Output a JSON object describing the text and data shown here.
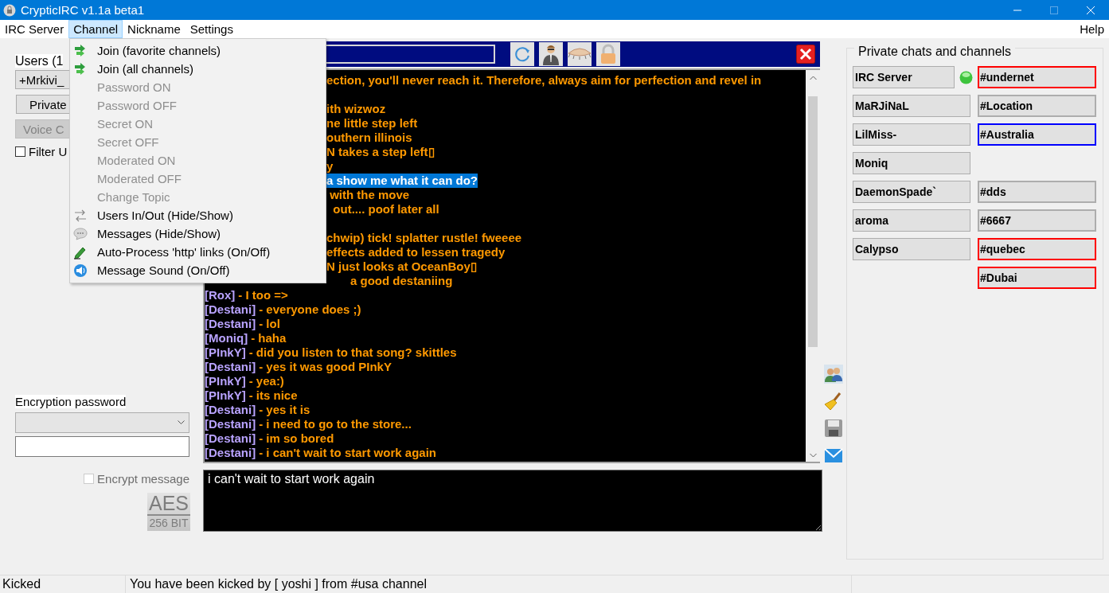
{
  "window": {
    "title": "CrypticIRC v1.1a beta1"
  },
  "menu_bar": [
    {
      "label": "IRC Server",
      "selected": false
    },
    {
      "label": "Channel",
      "selected": true
    },
    {
      "label": "Nickname",
      "selected": false
    },
    {
      "label": "Settings",
      "selected": false
    }
  ],
  "help_menu": "Help",
  "channel_menu": [
    {
      "label": "Join (favorite channels)",
      "kind": "join",
      "disabled": false
    },
    {
      "label": "Join (all channels)",
      "kind": "join",
      "disabled": false
    },
    {
      "label": "Password ON",
      "kind": "plain",
      "disabled": true
    },
    {
      "label": "Password OFF",
      "kind": "plain",
      "disabled": true
    },
    {
      "label": "Secret ON",
      "kind": "plain",
      "disabled": true
    },
    {
      "label": "Secret OFF",
      "kind": "plain",
      "disabled": true
    },
    {
      "label": "Moderated ON",
      "kind": "plain",
      "disabled": true
    },
    {
      "label": "Moderated OFF",
      "kind": "plain",
      "disabled": true
    },
    {
      "label": "Change Topic",
      "kind": "plain",
      "disabled": true
    },
    {
      "label": "Users In/Out (Hide/Show)",
      "kind": "users",
      "disabled": false
    },
    {
      "label": "Messages (Hide/Show)",
      "kind": "messages",
      "disabled": false
    },
    {
      "label": "Auto-Process 'http' links (On/Off)",
      "kind": "link",
      "disabled": false
    },
    {
      "label": "Message Sound (On/Off)",
      "kind": "sound",
      "disabled": false
    }
  ],
  "left_panel": {
    "users_label": "Users (1",
    "user": "+Mrkivi_",
    "private_button": {
      "label": "Private",
      "disabled": false
    },
    "voice_button": {
      "label": "Voice C",
      "disabled": true
    },
    "filter": {
      "label": "Filter U",
      "checked": false
    },
    "encryption_label": "Encryption password",
    "encrypt_message": {
      "label": "Encrypt message",
      "checked": false,
      "disabled": true
    },
    "aes_badge": {
      "top": "AES",
      "bottom": "256 BIT"
    }
  },
  "chat": [
    {
      "kind": "partial",
      "text": "ection, you'll never reach it. Therefore, always aim for perfection and revel in"
    },
    {
      "kind": "blank"
    },
    {
      "kind": "partial",
      "text": "ith wizwoz"
    },
    {
      "kind": "partial",
      "text": "ne little step left"
    },
    {
      "kind": "partial",
      "text": "outhern illinois"
    },
    {
      "kind": "partial",
      "text": "N takes a step left▯"
    },
    {
      "kind": "partial",
      "text": "y"
    },
    {
      "kind": "highlighted",
      "text": "a show me what it can do?"
    },
    {
      "kind": "partial",
      "text": " with the move"
    },
    {
      "kind": "partial",
      "text": "  out.... poof later all"
    },
    {
      "kind": "blank"
    },
    {
      "kind": "partial",
      "text": "chwip) tick! splatter rustle! fweeee"
    },
    {
      "kind": "partial",
      "text": "effects added to lessen tragedy"
    },
    {
      "kind": "partial",
      "text": "N just looks at OceanBoy▯"
    },
    {
      "kind": "tail",
      "text": "a good destaniing"
    },
    {
      "kind": "message",
      "nick": "[Rox]",
      "text": "- I too =>"
    },
    {
      "kind": "message",
      "nick": "[Destani]",
      "text": "- everyone does ;)"
    },
    {
      "kind": "message",
      "nick": "[Destani]",
      "text": "- lol"
    },
    {
      "kind": "message",
      "nick": "[Moniq]",
      "text": "- haha"
    },
    {
      "kind": "message",
      "nick": "[PInkY]",
      "text": "- did you listen to that song? skittles"
    },
    {
      "kind": "message",
      "nick": "[Destani]",
      "text": "- yes it was good PInkY"
    },
    {
      "kind": "message",
      "nick": "[PInkY]",
      "text": "- yea:)"
    },
    {
      "kind": "message",
      "nick": "[PInkY]",
      "text": "- its nice"
    },
    {
      "kind": "message",
      "nick": "[Destani]",
      "text": "- yes it is"
    },
    {
      "kind": "message",
      "nick": "[Destani]",
      "text": "- i need to go to the store..."
    },
    {
      "kind": "message",
      "nick": "[Destani]",
      "text": "- im so bored"
    },
    {
      "kind": "message",
      "nick": "[Destani]",
      "text": "- i can't wait to start work again"
    }
  ],
  "message_input": {
    "value": "i can't wait to start work again"
  },
  "right_panel": {
    "title": "Private chats and channels",
    "rows": [
      {
        "chat": {
          "label": "IRC Server",
          "connected": true
        },
        "channel": {
          "label": "#undernet",
          "color": "#ff0000"
        }
      },
      {
        "chat": {
          "label": "MaRJiNaL"
        },
        "channel": {
          "label": "#Location",
          "color": "#adadad"
        }
      },
      {
        "chat": {
          "label": "LilMiss-"
        },
        "channel": {
          "label": "#Australia",
          "color": "#0000ff"
        }
      },
      {
        "chat": {
          "label": "Moniq"
        }
      },
      {
        "chat": {
          "label": "DaemonSpade`"
        },
        "channel": {
          "label": "#dds",
          "color": "#adadad"
        }
      },
      {
        "chat": {
          "label": "aroma"
        },
        "channel": {
          "label": "#6667",
          "color": "#adadad"
        }
      },
      {
        "chat": {
          "label": "Calypso"
        },
        "channel": {
          "label": "#quebec",
          "color": "#ff0000"
        }
      },
      {
        "channel": {
          "label": "#Dubai",
          "color": "#ff0000"
        }
      }
    ]
  },
  "status_bar": {
    "status": "Kicked",
    "message": "You have been kicked by [ yoshi ] from #usa channel"
  }
}
